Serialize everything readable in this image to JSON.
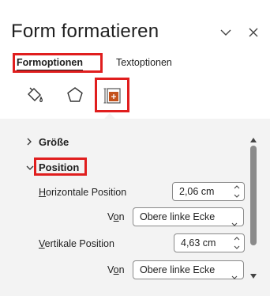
{
  "pane": {
    "title": "Form formatieren"
  },
  "tabs": [
    {
      "label": "Formoptionen",
      "active": true
    },
    {
      "label": "Textoptionen",
      "active": false
    }
  ],
  "icon_tabs": [
    {
      "icon": "fill-line-icon"
    },
    {
      "icon": "effects-pentagon-icon"
    },
    {
      "icon": "size-properties-icon",
      "active": true
    }
  ],
  "sections": {
    "size": {
      "label": "Größe",
      "expanded": false
    },
    "position": {
      "label": "Position",
      "expanded": true,
      "horizontal": {
        "label_pre": "",
        "label_ul": "H",
        "label_post": "orizontale Position",
        "value": "2,06 cm",
        "from_pre": "V",
        "from_ul": "o",
        "from_post": "n",
        "from_value": "Obere linke Ecke"
      },
      "vertical": {
        "label_pre": "",
        "label_ul": "V",
        "label_post": "ertikale Position",
        "value": "4,63 cm",
        "from_pre": "V",
        "from_ul": "o",
        "from_post": "n",
        "from_value": "Obere linke Ecke"
      }
    }
  },
  "colors": {
    "highlight": "#e01e1e",
    "accent_orange": "#c4521c"
  }
}
